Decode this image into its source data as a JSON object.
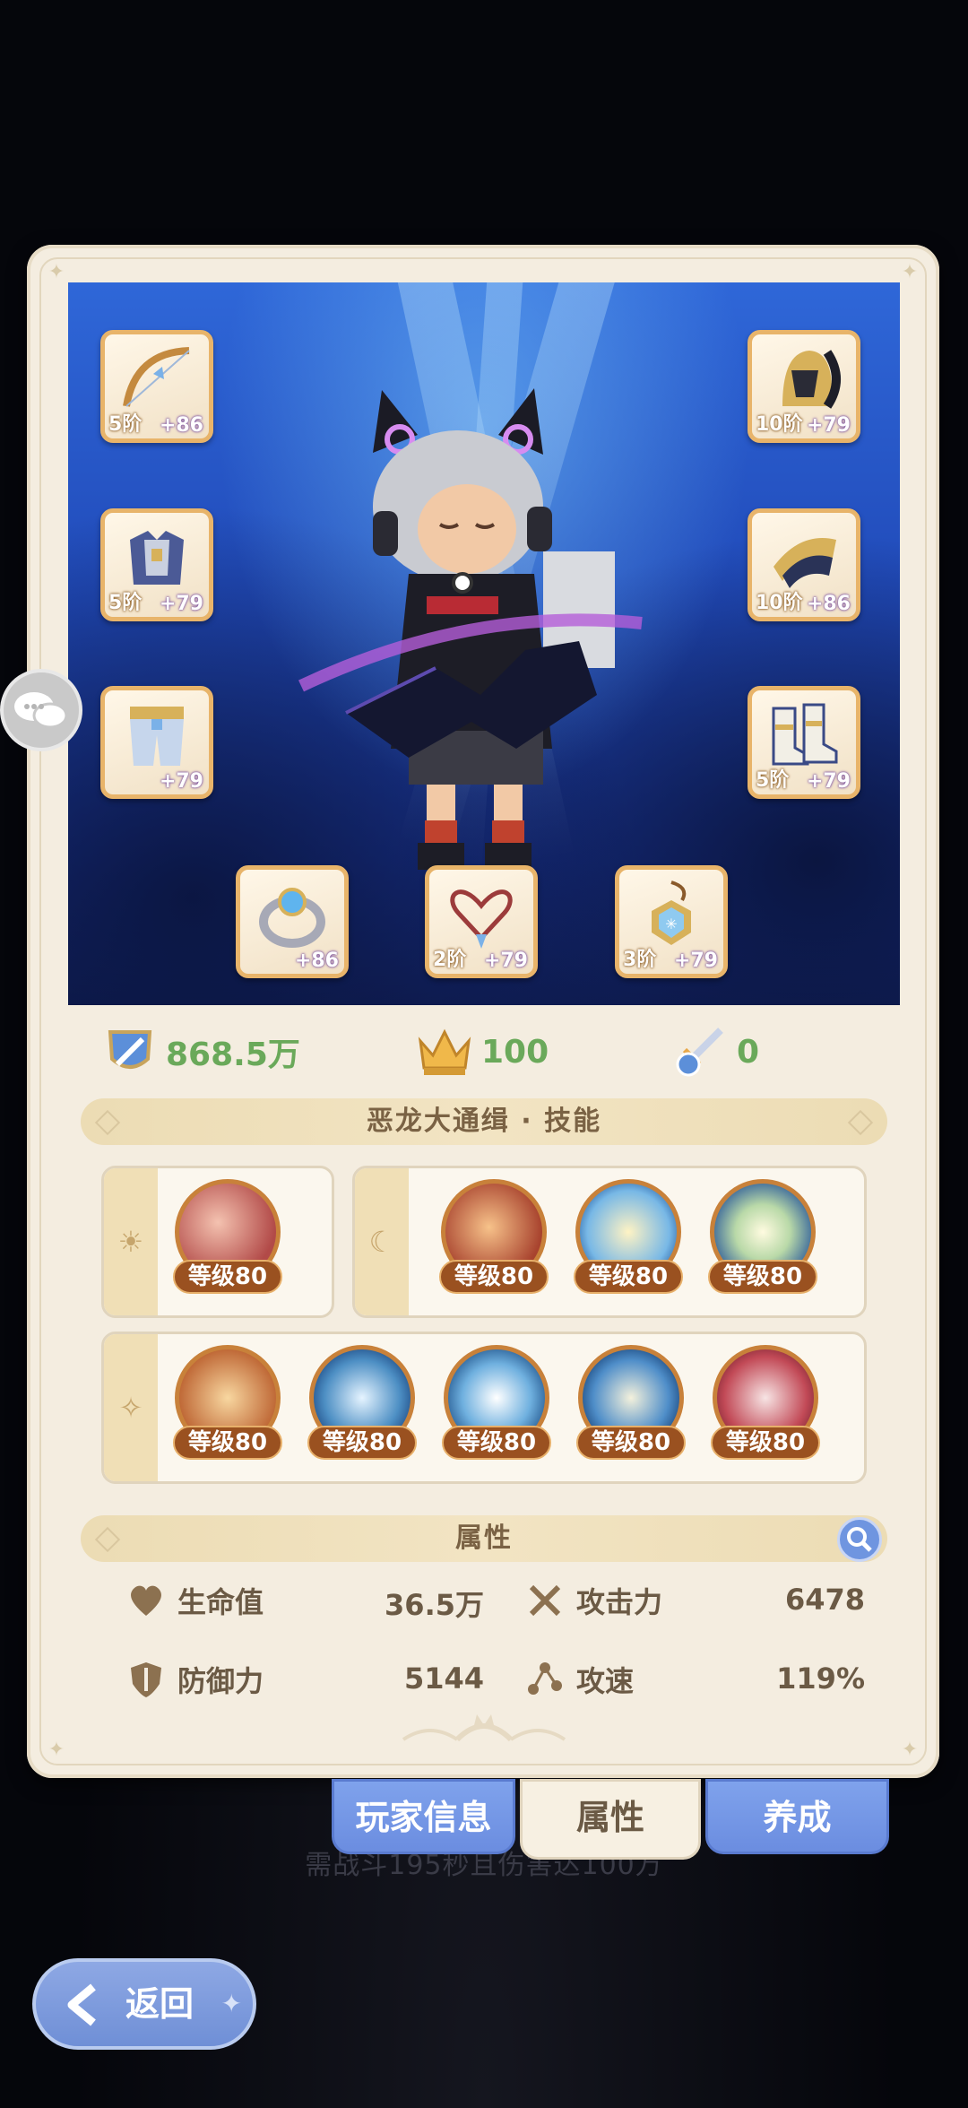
{
  "background_hint": "需战斗195秒且伤害达100万",
  "stats": {
    "power": "868.5万",
    "level": "100",
    "speed_score": "0"
  },
  "equipment": [
    {
      "slot": "bow",
      "tier": "5阶",
      "plus": "+86"
    },
    {
      "slot": "helmet",
      "tier": "10阶",
      "plus": "+79"
    },
    {
      "slot": "armor",
      "tier": "5阶",
      "plus": "+79"
    },
    {
      "slot": "shoulder",
      "tier": "10阶",
      "plus": "+86"
    },
    {
      "slot": "pants",
      "tier": "",
      "plus": "+79"
    },
    {
      "slot": "boots",
      "tier": "5阶",
      "plus": "+79"
    },
    {
      "slot": "ring",
      "tier": "",
      "plus": "+86"
    },
    {
      "slot": "necklace",
      "tier": "2阶",
      "plus": "+79"
    },
    {
      "slot": "amulet",
      "tier": "3阶",
      "plus": "+79"
    }
  ],
  "skills_banner": "恶龙大通缉 · 技能",
  "skill_groups": {
    "sun": {
      "icon": "sun-icon",
      "skills": [
        {
          "level": "等级80"
        }
      ]
    },
    "moon": {
      "icon": "moon-icon",
      "skills": [
        {
          "level": "等级80"
        },
        {
          "level": "等级80"
        },
        {
          "level": "等级80"
        }
      ]
    },
    "star": {
      "icon": "star-icon",
      "skills": [
        {
          "level": "等级80"
        },
        {
          "level": "等级80"
        },
        {
          "level": "等级80"
        },
        {
          "level": "等级80"
        },
        {
          "level": "等级80"
        }
      ]
    }
  },
  "attributes_banner": "属性",
  "attributes": {
    "hp": {
      "label": "生命值",
      "value": "36.5万"
    },
    "attack": {
      "label": "攻击力",
      "value": "6478"
    },
    "defense": {
      "label": "防御力",
      "value": "5144"
    },
    "attack_speed": {
      "label": "攻速",
      "value": "119%"
    }
  },
  "tabs": [
    {
      "label": "玩家信息",
      "active": false
    },
    {
      "label": "属性",
      "active": true
    },
    {
      "label": "养成",
      "active": false
    }
  ],
  "back_label": "返回",
  "colors": {
    "accent_green": "#6aa95a",
    "tab_blue": "#7fa2ec",
    "card_bg": "#f4ede0"
  }
}
